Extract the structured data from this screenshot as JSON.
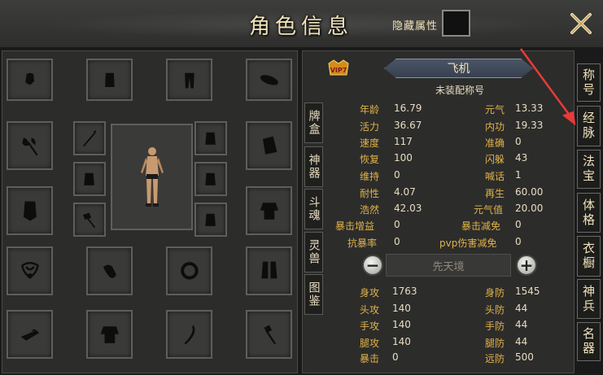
{
  "header": {
    "title": "角色信息",
    "hidden_attr_label": "隐藏属性"
  },
  "character": {
    "name": "飞机",
    "title_status": "未装配称号",
    "vip_label": "VIP7"
  },
  "left_tabs": [
    {
      "label": "牌盒"
    },
    {
      "label": "神器"
    },
    {
      "label": "斗魂"
    },
    {
      "label": "灵兽"
    },
    {
      "label": "图鉴"
    }
  ],
  "right_tabs": [
    {
      "label": "称号"
    },
    {
      "label": "经脉"
    },
    {
      "label": "法宝"
    },
    {
      "label": "体格"
    },
    {
      "label": "衣橱"
    },
    {
      "label": "神兵"
    },
    {
      "label": "名器"
    }
  ],
  "stats_upper": [
    {
      "l_label": "年龄",
      "l_value": "16.79",
      "r_label": "元气",
      "r_value": "13.33"
    },
    {
      "l_label": "活力",
      "l_value": "36.67",
      "r_label": "内功",
      "r_value": "19.33"
    },
    {
      "l_label": "速度",
      "l_value": "117",
      "r_label": "准确",
      "r_value": "0"
    },
    {
      "l_label": "恢复",
      "l_value": "100",
      "r_label": "闪躲",
      "r_value": "43"
    },
    {
      "l_label": "维持",
      "l_value": "0",
      "r_label": "喊话",
      "r_value": "1"
    },
    {
      "l_label": "耐性",
      "l_value": "4.07",
      "r_label": "再生",
      "r_value": "60.00"
    },
    {
      "l_label": "浩然",
      "l_value": "42.03",
      "r_label": "元气值",
      "r_value": "20.00"
    },
    {
      "l_label": "暴击增益",
      "l_value": "0",
      "r_label": "暴击减免",
      "r_value": "0"
    },
    {
      "l_label": "抗暴率",
      "l_value": "0",
      "r_label": "pvp伤害减免",
      "r_value": "0"
    }
  ],
  "realm": {
    "label": "先天境",
    "minus": "−",
    "plus": "+"
  },
  "stats_lower": [
    {
      "l_label": "身攻",
      "l_value": "1763",
      "r_label": "身防",
      "r_value": "1545"
    },
    {
      "l_label": "头攻",
      "l_value": "140",
      "r_label": "头防",
      "r_value": "44"
    },
    {
      "l_label": "手攻",
      "l_value": "140",
      "r_label": "手防",
      "r_value": "44"
    },
    {
      "l_label": "腿攻",
      "l_value": "140",
      "r_label": "腿防",
      "r_value": "44"
    },
    {
      "l_label": "暴击",
      "l_value": "0",
      "r_label": "远防",
      "r_value": "500"
    }
  ],
  "colors": {
    "label_gold": "#e0b24a",
    "value_text": "#e8dcc0",
    "arrow_red": "#e83a3a"
  },
  "equip_slot_icons": [
    "hair-icon",
    "chest-armor-icon",
    "pants-icon",
    "hat-icon",
    "axe-icon",
    "spear-icon",
    "vest-icon",
    "cape-icon",
    "shield-icon",
    "vest-icon",
    "vest-icon",
    "robe-icon",
    "hammer-icon",
    "vest-icon",
    "necklace-icon",
    "pendant-icon",
    "ring-icon",
    "boots-icon",
    "helmet-icon",
    "armor-icon",
    "blade-icon",
    "mace-icon"
  ]
}
